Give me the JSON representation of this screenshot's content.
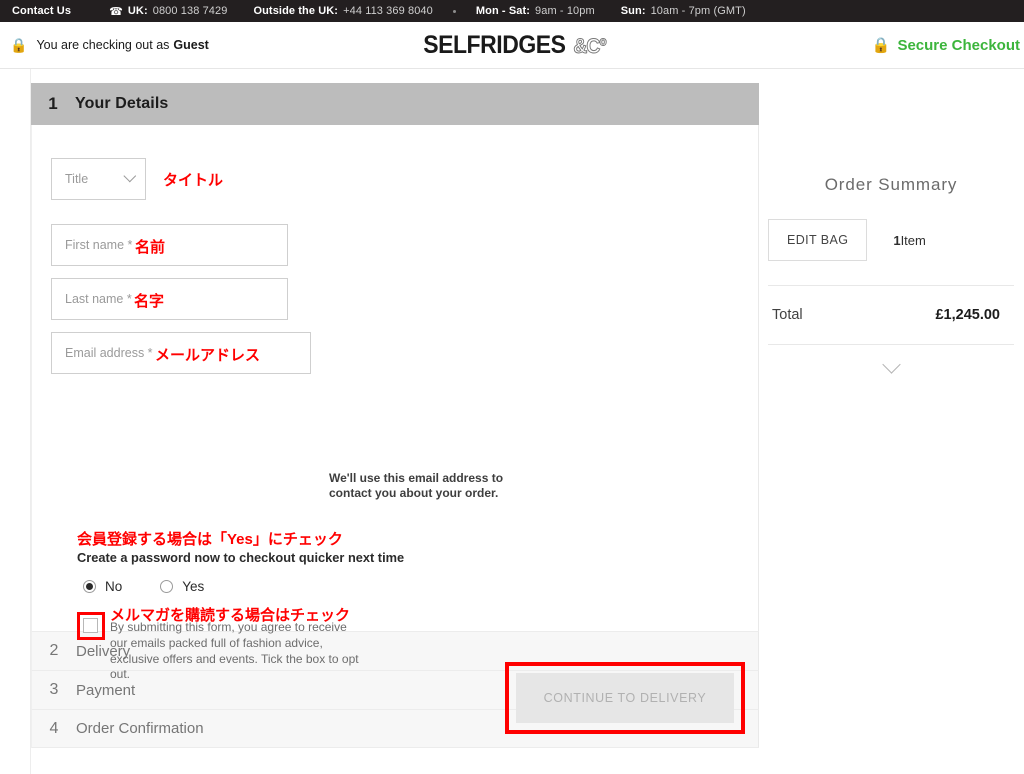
{
  "topbar": {
    "contact_us": "Contact Us",
    "phone_icon": "phone-icon",
    "uk_label": "UK:",
    "uk_number": "0800 138 7429",
    "outside_label": "Outside the UK:",
    "outside_number": "+44 113 369 8040",
    "separator": "•",
    "weekday_label": "Mon - Sat:",
    "weekday_hours": "9am - 10pm",
    "sunday_label": "Sun:",
    "sunday_hours": "10am - 7pm (GMT)"
  },
  "header": {
    "lock_icon": "lock-icon",
    "guest_text": "You are checking out as",
    "guest_strong": "Guest",
    "logo_main": "SELFRIDGES",
    "logo_suffix": "&Cº",
    "secure_lock_icon": "lock-icon",
    "secure_label": "Secure Checkout",
    "secure_color": "#3cb53c"
  },
  "steps": {
    "active": {
      "number": "1",
      "title": "Your Details"
    },
    "collapsed": [
      {
        "number": "2",
        "title": "Delivery"
      },
      {
        "number": "3",
        "title": "Payment"
      },
      {
        "number": "4",
        "title": "Order Confirmation"
      }
    ]
  },
  "form": {
    "title_select": {
      "placeholder": "Title",
      "value": ""
    },
    "title_annotation": "タイトル",
    "first_name": {
      "placeholder": "First name *",
      "value": ""
    },
    "first_name_annotation": "名前",
    "last_name": {
      "placeholder": "Last name *",
      "value": ""
    },
    "last_name_annotation": "名字",
    "email": {
      "placeholder": "Email address *",
      "value": ""
    },
    "email_annotation": "メールアドレス",
    "email_note": "We'll use this email address to contact you about your order.",
    "password_annotation": "会員登録する場合は「Yes」にチェック",
    "password_prompt": "Create a password now to checkout quicker next time",
    "radio_no": "No",
    "radio_yes": "Yes",
    "radio_selected": "No",
    "optin_annotation": "メルマガを購読する場合はチェック",
    "optin_text": "By submitting this form, you agree to receive our emails packed full of fashion advice, exclusive offers and events. Tick the box to opt out.",
    "optin_checked": false,
    "cta_label": "CONTINUE TO DELIVERY",
    "cta_disabled": true,
    "highlight_color": "#ff0000",
    "annotation_color": "#ff0000"
  },
  "summary": {
    "title": "Order Summary",
    "edit_bag_label": "EDIT BAG",
    "item_count_number": "1",
    "item_count_unit": "Item",
    "total_label": "Total",
    "total_value": "£1,245.00",
    "expand_icon": "chevron-down-icon"
  }
}
